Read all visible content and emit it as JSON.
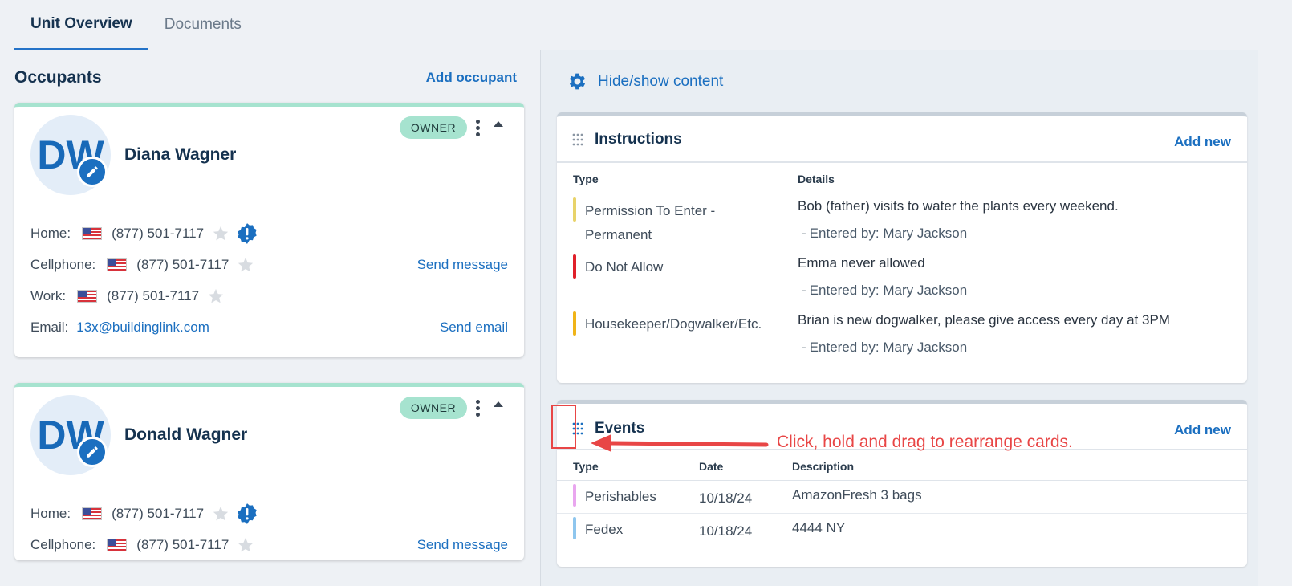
{
  "tabs": [
    {
      "label": "Unit Overview",
      "active": true
    },
    {
      "label": "Documents",
      "active": false
    }
  ],
  "occupants": {
    "title": "Occupants",
    "add_label": "Add occupant",
    "list": [
      {
        "initials": "DW",
        "name": "Diana Wagner",
        "badge": "OWNER",
        "home_label": "Home:",
        "home_phone": "(877) 501-7117",
        "cell_label": "Cellphone:",
        "cell_phone": "(877) 501-7117",
        "work_label": "Work:",
        "work_phone": "(877) 501-7117",
        "email_label": "Email:",
        "email": "13x@buildinglink.com",
        "send_message": "Send message",
        "send_email": "Send email"
      },
      {
        "initials": "DW",
        "name": "Donald Wagner",
        "badge": "OWNER",
        "home_label": "Home:",
        "home_phone": "(877) 501-7117",
        "cell_label": "Cellphone:",
        "cell_phone": "(877) 501-7117",
        "send_message": "Send message"
      }
    ]
  },
  "right": {
    "hide_show": "Hide/show content",
    "instructions": {
      "title": "Instructions",
      "add_new": "Add new",
      "columns": [
        "Type",
        "Details"
      ],
      "rows": [
        {
          "type_line1": "Permission To Enter -",
          "type_line2": "Permanent",
          "details": "Bob (father) visits to water the plants every weekend.",
          "entered_by": "Entered by: Mary Jackson",
          "color": "#e8d36a"
        },
        {
          "type_line1": "Do Not Allow",
          "type_line2": "",
          "details": "Emma never allowed",
          "entered_by": "Entered by: Mary Jackson",
          "color": "#e0202a"
        },
        {
          "type_line1": "Housekeeper/Dogwalker/Etc.",
          "type_line2": "",
          "details": "Brian is new dogwalker, please give access every day at 3PM",
          "entered_by": "Entered by: Mary Jackson",
          "color": "#f0b418"
        }
      ],
      "dash": "-"
    },
    "events": {
      "title": "Events",
      "add_new": "Add new",
      "columns": [
        "Type",
        "Date",
        "Description"
      ],
      "rows": [
        {
          "type": "Perishables",
          "date": "10/18/24",
          "description": "AmazonFresh 3 bags",
          "color": "#e9a6ef"
        },
        {
          "type": "Fedex",
          "date": "10/18/24",
          "description": "4444 NY",
          "color": "#8ec6ee"
        }
      ]
    }
  },
  "annotation": {
    "text": "Click, hold and drag to rearrange cards."
  },
  "colors": {
    "accent": "#1b6fc0",
    "owner_badge": "#a6e3cf",
    "annotation": "#e84646"
  },
  "icons": [
    "gear-icon",
    "grip-icon",
    "pencil-icon",
    "star-icon",
    "alert-icon",
    "kebab-icon",
    "caret-up-icon",
    "us-flag-icon"
  ]
}
